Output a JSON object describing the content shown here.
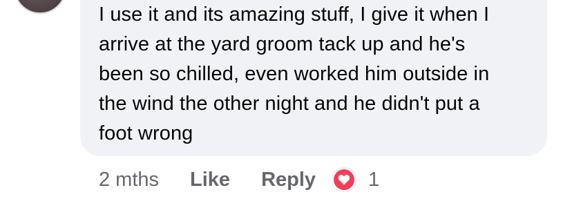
{
  "comment": {
    "text": "I use it and its amazing stuff, I give it when I\narrive at the yard groom tack up and he's\nbeen so chilled, even worked him outside in\nthe wind the other night and he didn't put a\nfoot wrong"
  },
  "actions": {
    "timestamp": "2 mths",
    "like_label": "Like",
    "reply_label": "Reply"
  },
  "reaction": {
    "icon": "heart-icon",
    "color": "#f33e58",
    "count": "1"
  }
}
